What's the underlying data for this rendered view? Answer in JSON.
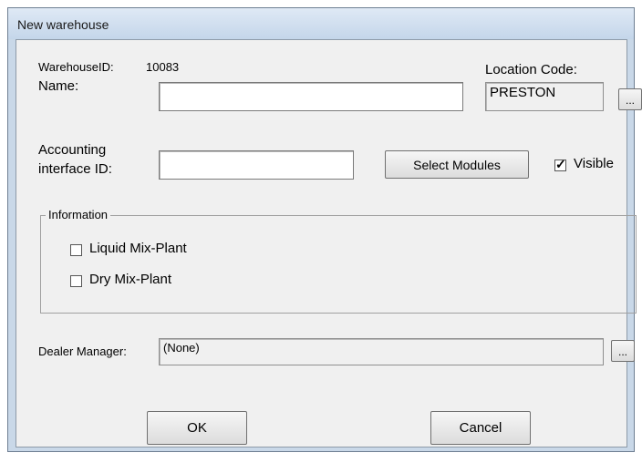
{
  "window": {
    "title": "New warehouse"
  },
  "warehouse": {
    "id_label": "WarehouseID:",
    "id_value": "10083",
    "name_label": "Name:",
    "name_value": "",
    "location_label": "Location Code:",
    "location_value": "PRESTON",
    "location_browse": "...",
    "accounting_label_line1": "Accounting",
    "accounting_label_line2": "interface ID:",
    "accounting_value": ""
  },
  "modules": {
    "select_label": "Select Modules"
  },
  "visible": {
    "label": "Visible",
    "checked": true,
    "mark": "✓"
  },
  "information": {
    "title": "Information",
    "options": [
      {
        "label": "Liquid Mix-Plant",
        "checked": false
      },
      {
        "label": "Dry Mix-Plant",
        "checked": false
      }
    ]
  },
  "dealer": {
    "label": "Dealer Manager:",
    "value": "(None)",
    "browse": "..."
  },
  "actions": {
    "ok": "OK",
    "cancel": "Cancel"
  }
}
